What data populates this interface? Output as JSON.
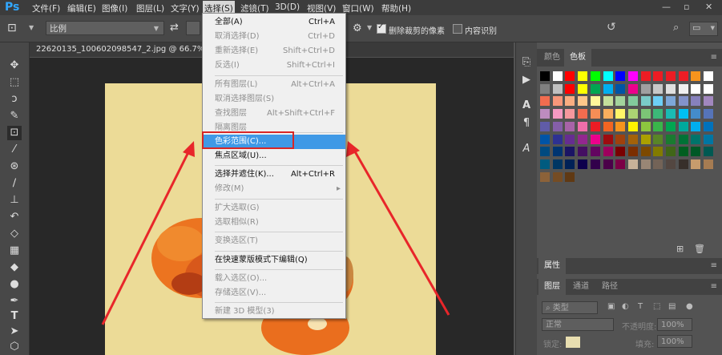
{
  "app": {
    "logo": "Ps"
  },
  "menubar": {
    "items": [
      "文件(F)",
      "编辑(E)",
      "图像(I)",
      "图层(L)",
      "文字(Y)",
      "选择(S)",
      "滤镜(T)",
      "3D(D)",
      "视图(V)",
      "窗口(W)",
      "帮助(H)"
    ],
    "active": "选择(S)",
    "window_controls": [
      "—",
      "▫",
      "✕"
    ]
  },
  "options": {
    "ratio": "比例",
    "delete_cropped": "删除裁剪的像素",
    "content_aware": "内容识别"
  },
  "document": {
    "tab_title": "22620135_100602098547_2.jpg @ 66.7%(RGB/"
  },
  "select_menu": {
    "items": [
      {
        "label": "全部(A)",
        "shortcut": "Ctrl+A",
        "state": "enabled"
      },
      {
        "label": "取消选择(D)",
        "shortcut": "Ctrl+D",
        "state": "disabled"
      },
      {
        "label": "重新选择(E)",
        "shortcut": "Shift+Ctrl+D",
        "state": "disabled"
      },
      {
        "label": "反选(I)",
        "shortcut": "Shift+Ctrl+I",
        "state": "disabled"
      },
      {
        "label": "所有图层(L)",
        "shortcut": "Alt+Ctrl+A",
        "state": "disabled"
      },
      {
        "label": "取消选择图层(S)",
        "shortcut": "",
        "state": "disabled"
      },
      {
        "label": "查找图层",
        "shortcut": "Alt+Shift+Ctrl+F",
        "state": "disabled"
      },
      {
        "label": "隔离图层",
        "shortcut": "",
        "state": "disabled"
      },
      {
        "label": "色彩范围(C)...",
        "shortcut": "",
        "state": "highlighted"
      },
      {
        "label": "焦点区域(U)...",
        "shortcut": "",
        "state": "enabled"
      },
      {
        "label": "选择并遮住(K)...",
        "shortcut": "Alt+Ctrl+R",
        "state": "enabled"
      },
      {
        "label": "修改(M)",
        "shortcut": "▸",
        "state": "disabled"
      },
      {
        "label": "扩大选取(G)",
        "shortcut": "",
        "state": "disabled"
      },
      {
        "label": "选取相似(R)",
        "shortcut": "",
        "state": "disabled"
      },
      {
        "label": "变换选区(T)",
        "shortcut": "",
        "state": "disabled"
      },
      {
        "label": "在快速蒙版模式下编辑(Q)",
        "shortcut": "",
        "state": "enabled"
      },
      {
        "label": "载入选区(O)...",
        "shortcut": "",
        "state": "disabled"
      },
      {
        "label": "存储选区(V)...",
        "shortcut": "",
        "state": "disabled"
      },
      {
        "label": "新建 3D 模型(3)",
        "shortcut": "",
        "state": "disabled"
      }
    ]
  },
  "panels": {
    "color_tabs": [
      "颜色",
      "色板"
    ],
    "color_tab_active": "色板",
    "properties_tab": "属性",
    "layer_tabs": [
      "图层",
      "通道",
      "路径"
    ],
    "layer_tab_active": "图层",
    "kind_label": "类型",
    "blend_mode": "正常",
    "opacity_label": "不透明度:",
    "opacity_value": "100%",
    "lock_label": "锁定:",
    "fill_label": "填充:",
    "fill_value": "100%"
  },
  "swatches": {
    "colors": [
      "#000000",
      "#ffffff",
      "#ff0000",
      "#ffff00",
      "#00ff00",
      "#00ffff",
      "#0000ff",
      "#ff00ff",
      "#ec1c24",
      "#ed1c24",
      "#ed1c24",
      "#ee1d25",
      "#f7941d",
      "#ffffff",
      "#808080",
      "#c0c0c0",
      "#ff0000",
      "#ffff00",
      "#00a651",
      "#00aeef",
      "#0054a6",
      "#ec008c",
      "#a0a0a0",
      "#c8c8c8",
      "#e0e0e0",
      "#f0f0f0",
      "#ffffff",
      "#ffffff",
      "#f26c4f",
      "#f7977a",
      "#f9ad81",
      "#fdc68a",
      "#fff79a",
      "#c4df9b",
      "#a3d39c",
      "#82ca9c",
      "#7accc8",
      "#6dcff6",
      "#7da7d9",
      "#8393ca",
      "#8781bd",
      "#a187be",
      "#bd8cbf",
      "#f49ac2",
      "#f5989d",
      "#f26c4f",
      "#f68e56",
      "#fbaf5d",
      "#fff568",
      "#acd373",
      "#7cc576",
      "#3cb878",
      "#1abbb4",
      "#00bff3",
      "#448ccb",
      "#5674b9",
      "#605ca8",
      "#855fa8",
      "#a863a8",
      "#f06eaa",
      "#ed1c24",
      "#f26522",
      "#f7941d",
      "#fff200",
      "#8dc63f",
      "#39b54a",
      "#00a651",
      "#00a99d",
      "#00aeef",
      "#0072bc",
      "#0054a6",
      "#2e3192",
      "#662d91",
      "#92278f",
      "#ec008c",
      "#9e0b0f",
      "#a0410d",
      "#a36209",
      "#aba000",
      "#598527",
      "#197b30",
      "#007236",
      "#00746b",
      "#0076a3",
      "#004a80",
      "#003471",
      "#1b1464",
      "#440e62",
      "#630460",
      "#9e005d",
      "#790000",
      "#7b2e00",
      "#7d4900",
      "#827b00",
      "#406618",
      "#005e20",
      "#005826",
      "#005952",
      "#005b7f",
      "#003663",
      "#002157",
      "#0d004c",
      "#32004b",
      "#4b0049",
      "#7b0046",
      "#c7b299",
      "#998675",
      "#736357",
      "#534741",
      "#372f2a",
      "#c69c6d",
      "#a67c52",
      "#8c6239",
      "#754c24",
      "#603913"
    ]
  }
}
